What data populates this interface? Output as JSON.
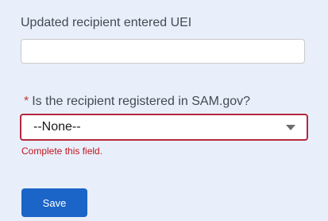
{
  "uei_field": {
    "label": "Updated recipient entered UEI",
    "value": ""
  },
  "sam_field": {
    "required_marker": "*",
    "label": "Is the recipient registered in SAM.gov?",
    "selected": "--None--",
    "error": "Complete this field."
  },
  "actions": {
    "save_label": "Save"
  },
  "colors": {
    "background": "#e8effb",
    "error": "#c2141c",
    "error_border": "#b3283f",
    "primary": "#1b64c8"
  },
  "icons": {
    "select_arrow": "chevron-down-icon"
  }
}
